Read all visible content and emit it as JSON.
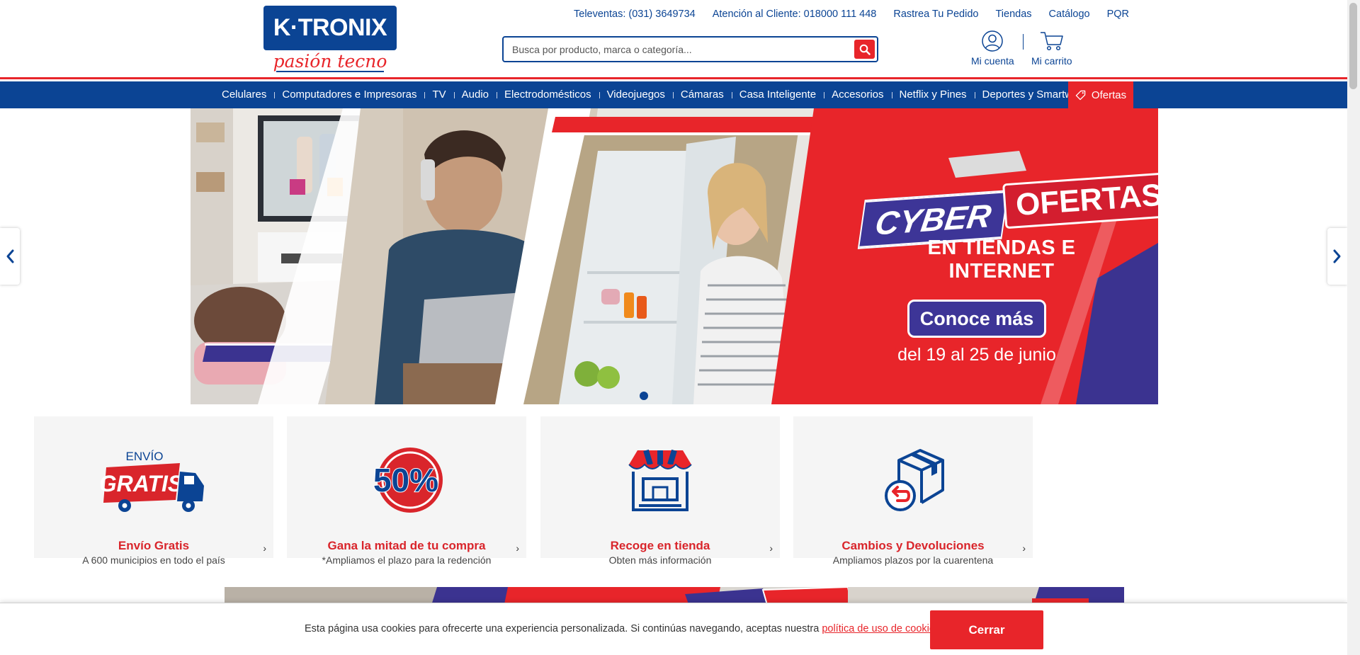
{
  "brand": {
    "logo_text": "K·TRONIX",
    "tagline": "pasión tecno",
    "color_primary": "#0b4494",
    "color_accent": "#e8252a"
  },
  "top_links": [
    {
      "label": "Televentas: (031) 3649734"
    },
    {
      "label": "Atención al Cliente: 018000 111 448"
    },
    {
      "label": "Rastrea Tu Pedido"
    },
    {
      "label": "Tiendas"
    },
    {
      "label": "Catálogo"
    },
    {
      "label": "PQR"
    }
  ],
  "search": {
    "placeholder": "Busca por producto, marca o categoría...",
    "value": "",
    "icon": "search-icon"
  },
  "account": {
    "label": "Mi cuenta",
    "icon": "user-icon"
  },
  "cart": {
    "label": "Mi carrito",
    "icon": "cart-icon"
  },
  "nav": {
    "items": [
      {
        "label": "Celulares"
      },
      {
        "label": "Computadores e Impresoras"
      },
      {
        "label": "TV"
      },
      {
        "label": "Audio"
      },
      {
        "label": "Electrodomésticos"
      },
      {
        "label": "Videojuegos"
      },
      {
        "label": "Cámaras"
      },
      {
        "label": "Casa Inteligente"
      },
      {
        "label": "Accesorios"
      },
      {
        "label": "Netflix y Pines"
      },
      {
        "label": "Deportes y Smartwatch"
      }
    ],
    "offers": {
      "label": "Ofertas",
      "icon": "tag-icon"
    }
  },
  "hero": {
    "title_left": "CYBER",
    "title_right": "OFERTAS",
    "subtitle": "EN TIENDAS E INTERNET",
    "cta": "Conoce más",
    "dates": "del 19 al 25 de junio",
    "prev_icon": "chevron-left-icon",
    "next_icon": "chevron-right-icon"
  },
  "benefits": [
    {
      "icon": "free-shipping-truck-icon",
      "badge_top": "ENVÍO",
      "badge_main": "GRATIS",
      "title": "Envío Gratis",
      "subtitle": "A 600 municipios en todo el país"
    },
    {
      "icon": "fifty-percent-icon",
      "badge_main": "50%",
      "title": "Gana la mitad de tu compra",
      "subtitle": "*Ampliamos el plazo para la redención"
    },
    {
      "icon": "store-pickup-icon",
      "title": "Recoge en tienda",
      "subtitle": "Obten más información"
    },
    {
      "icon": "returns-box-icon",
      "title": "Cambios y Devoluciones",
      "subtitle": "Ampliamos plazos por la cuarentena"
    }
  ],
  "cookie": {
    "text": "Esta página usa cookies para ofrecerte una experiencia personalizada. Si continúas navegando, aceptas nuestra ",
    "link": "política de uso de cookies",
    "suffix": ".",
    "button": "Cerrar"
  }
}
